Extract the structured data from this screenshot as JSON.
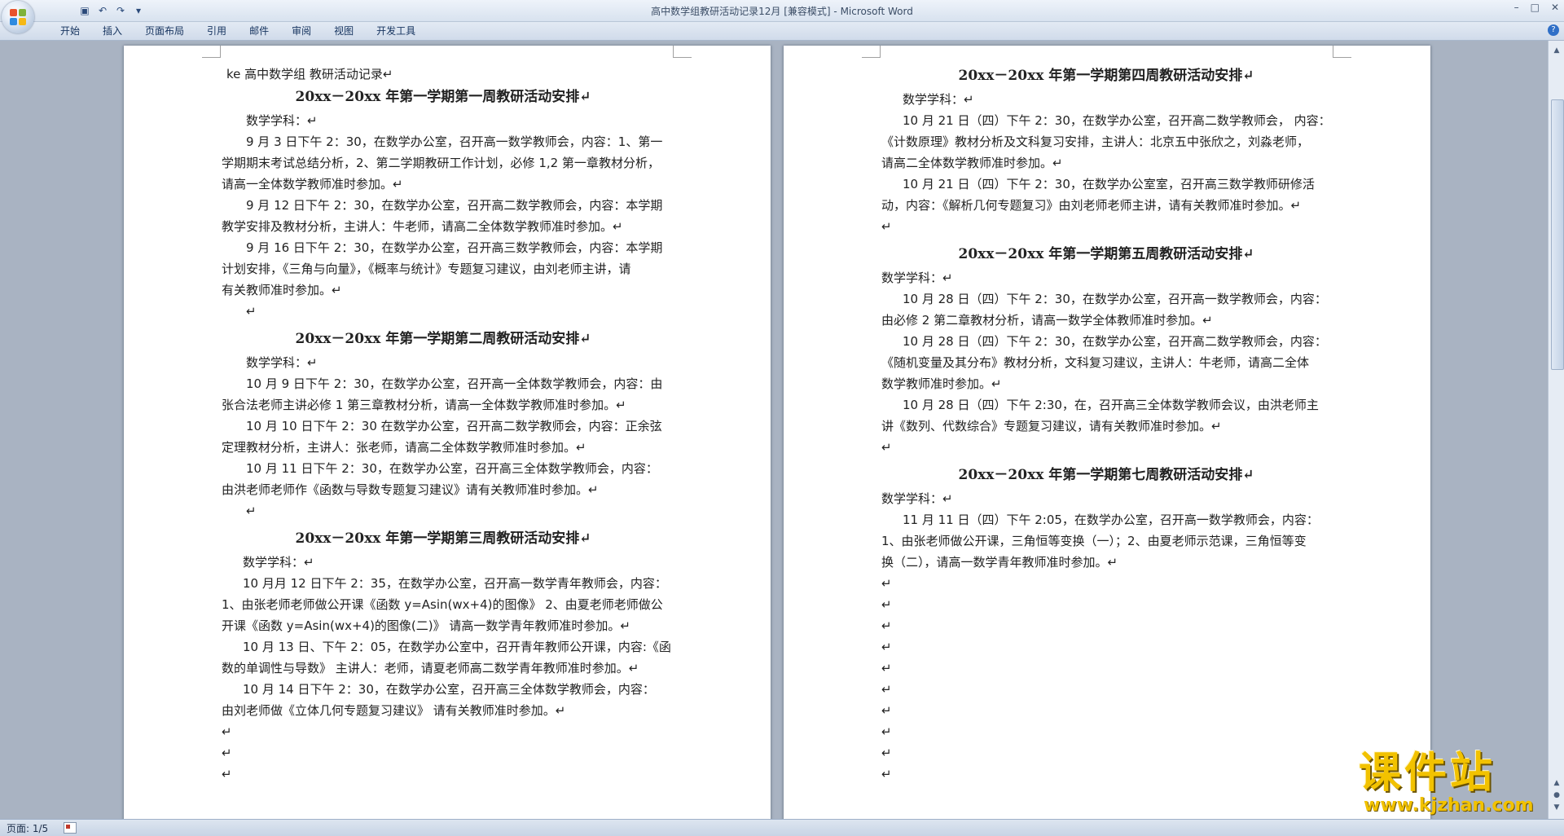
{
  "window": {
    "title": "高中数学组教研活动记录12月 [兼容模式] - Microsoft Word",
    "controls": [
      "–",
      "□",
      "✕"
    ]
  },
  "qat": {
    "save_icon": "save-icon",
    "undo_icon": "undo-icon",
    "redo_icon": "redo-icon"
  },
  "ribbon": {
    "tabs": [
      "开始",
      "插入",
      "页面布局",
      "引用",
      "邮件",
      "审阅",
      "视图",
      "开发工具"
    ],
    "help": "?"
  },
  "left_page": {
    "lines": [
      "ke 高中数学组  教研活动记录↵",
      "20xx－20xx 年第一学期第一周教研活动安排↵",
      "数学学科：↵",
      "9 月 3 日下午 2：30，在数学办公室，召开高一数学教师会，内容：1、第一",
      "学期期末考试总结分析，2、第二学期教研工作计划，必修 1,2 第一章教材分析，",
      "请高一全体数学教师准时参加。↵",
      "9 月 12 日下午 2：30，在数学办公室，召开高二数学教师会，内容：本学期",
      "教学安排及教材分析，主讲人：牛老师，请高二全体数学教师准时参加。↵",
      "9 月 16 日下午 2：30，在数学办公室，召开高三数学教师会，内容：本学期",
      "计划安排，《三角与向量》，《概率与统计》专题复习建议，由刘老师主讲，请",
      "有关教师准时参加。↵",
      "↵",
      "20xx－20xx 年第一学期第二周教研活动安排↵",
      "数学学科：↵",
      "10 月 9 日下午 2：30，在数学办公室，召开高一全体数学教师会，内容：由",
      "张合法老师主讲必修 1 第三章教材分析，请高一全体数学教师准时参加。↵",
      "10 月 10 日下午 2：30 在数学办公室，召开高二数学教师会，内容：正余弦",
      "定理教材分析，主讲人：张老师，请高二全体数学教师准时参加。↵",
      "10 月 11 日下午 2：30，在数学办公室，召开高三全体数学教师会，内容：",
      "由洪老师老师作《函数与导数专题复习建议》请有关教师准时参加。↵",
      "↵",
      "20xx－20xx 年第一学期第三周教研活动安排↵",
      "数学学科：↵",
      "10 月月 12 日下午 2：35，在数学办公室，召开高一数学青年教师会，内容：",
      "1、由张老师老师做公开课《函数 y=Asin(wx+4)的图像》 2、由夏老师老师做公",
      "开课《函数 y=Asin(wx+4)的图像(二)》 请高一数学青年教师准时参加。↵",
      "10 月 13 日、下午 2：05，在数学办公室中，召开青年教师公开课，内容:《函",
      "数的单调性与导数》 主讲人：老师，请夏老师高二数学青年教师准时参加。↵",
      "10 月 14 日下午 2：30，在数学办公室，召开高三全体数学教师会，内容：",
      "由刘老师做《立体几何专题复习建议》 请有关教师准时参加。↵",
      "↵",
      "↵",
      "↵"
    ]
  },
  "right_page": {
    "lines": [
      "20xx－20xx 年第一学期第四周教研活动安排↵",
      "数学学科：↵",
      "10 月 21 日（四）下午 2：30，在数学办公室，召开高二数学教师会， 内容：",
      "《计数原理》教材分析及文科复习安排，主讲人：北京五中张欣之，刘淼老师，",
      "请高二全体数学教师准时参加。↵",
      "10 月 21 日（四）下午 2：30，在数学办公室室，召开高三数学教师研修活",
      "动，内容：《解析几何专题复习》由刘老师老师主讲，请有关教师准时参加。↵",
      "↵",
      "20xx－20xx 年第一学期第五周教研活动安排↵",
      "数学学科：↵",
      "10 月 28 日（四）下午 2：30，在数学办公室，召开高一数学教师会，内容：",
      "由必修 2 第二章教材分析，请高一数学全体教师准时参加。↵",
      "10 月 28 日（四）下午 2：30，在数学办公室，召开高二数学教师会，内容：",
      "《随机变量及其分布》教材分析，文科复习建议，主讲人：牛老师，请高二全体",
      "数学教师准时参加。↵",
      "10 月 28 日（四）下午 2:30，在，召开高三全体数学教师会议，由洪老师主",
      "讲《数列、代数综合》专题复习建议，请有关教师准时参加。↵",
      "↵",
      "20xx－20xx 年第一学期第七周教研活动安排↵",
      "数学学科：↵",
      "11 月 11 日（四）下午 2:05，在数学办公室，召开高一数学教师会，内容：",
      "1、由张老师做公开课，三角恒等变换（一）；2、由夏老师示范课，三角恒等变",
      "换（二），请高一数学青年教师准时参加。↵",
      "↵",
      "↵",
      "↵",
      "↵",
      "↵",
      "↵",
      "↵",
      "↵",
      "↵",
      "↵"
    ]
  },
  "status": {
    "page": "页面: 1/5"
  },
  "watermark": {
    "main": "课件站",
    "sub": "www.kjzhan.com"
  }
}
